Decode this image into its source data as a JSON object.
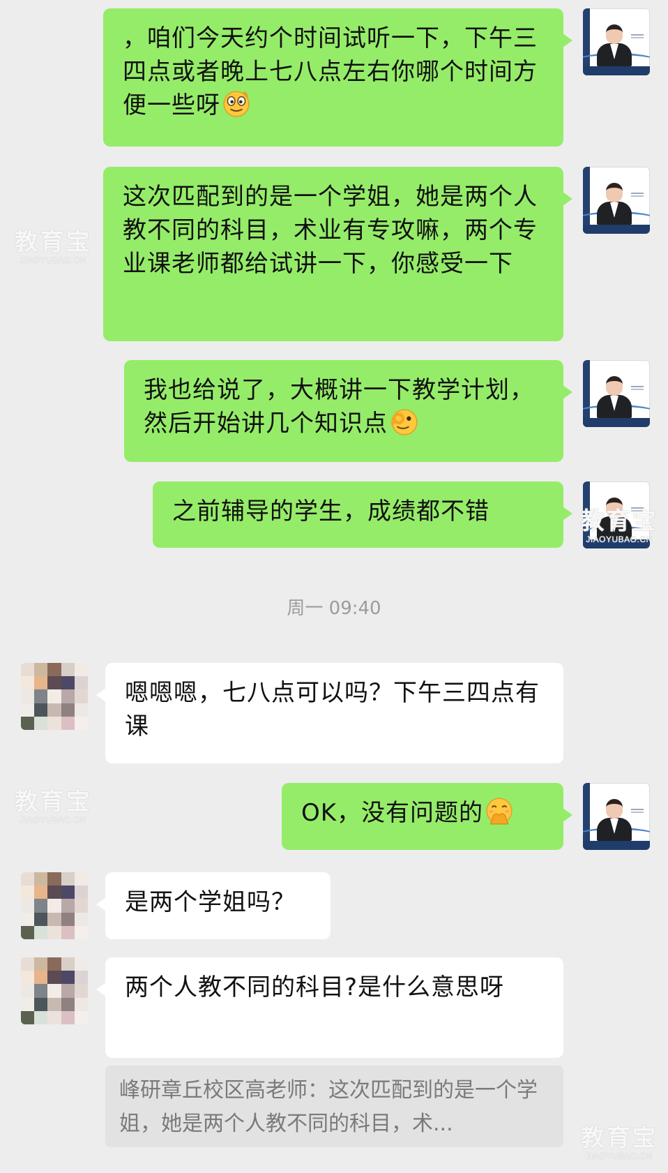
{
  "conversation": {
    "messages": [
      {
        "direction": "out",
        "text": "，咱们今天约个时间试听一下，下午三四点或者晚上七八点左右你哪个时间方便一些呀",
        "emoji": "grinning-monocle-emoji"
      },
      {
        "direction": "out",
        "text": "这次匹配到的是一个学姐，她是两个人教不同的科目，术业有专攻嘛，两个专业课老师都给试讲一下，你感受一下"
      },
      {
        "direction": "out",
        "text": "我也给说了，大概讲一下教学计划，然后开始讲几个知识点",
        "emoji": "ok-hand-face-emoji"
      },
      {
        "direction": "out",
        "text": "之前辅导的学生，成绩都不错"
      },
      {
        "direction": "in",
        "text": "嗯嗯嗯，七八点可以吗？下午三四点有课"
      },
      {
        "direction": "out",
        "text": "OK，没有问题的",
        "emoji": "shushing-face-emoji"
      },
      {
        "direction": "in",
        "text": "是两个学姐吗？"
      },
      {
        "direction": "in",
        "text": "两个人教不同的科目?是什么意思呀"
      }
    ],
    "timestamp": "周一 09:40",
    "quoted_reply": "峰研章丘校区高老师：这次匹配到的是一个学姐，她是两个人教不同的科目，术..."
  },
  "watermark": {
    "cn": "教育宝",
    "en": "JIAOYUBAO.CN"
  },
  "colors": {
    "background": "#ededed",
    "outgoing_bubble": "#95ec69",
    "incoming_bubble": "#ffffff",
    "quote_background": "#e2e2e2",
    "timestamp_text": "#9c9c9c"
  }
}
